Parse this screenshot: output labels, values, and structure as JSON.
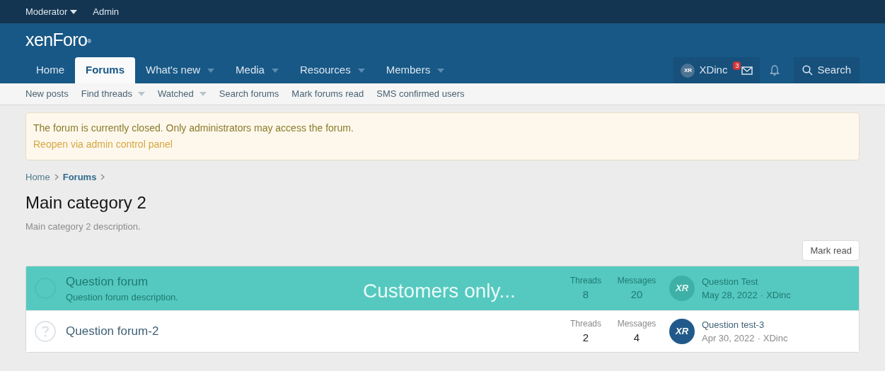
{
  "staff_bar": [
    {
      "label": "Moderator",
      "dropdown": true
    },
    {
      "label": "Admin",
      "dropdown": false
    }
  ],
  "logo": {
    "text": "xenForo",
    "mark": "®"
  },
  "nav_tabs": [
    {
      "label": "Home",
      "selected": false,
      "dropdown": false
    },
    {
      "label": "Forums",
      "selected": true,
      "dropdown": false
    },
    {
      "label": "What's new",
      "selected": false,
      "dropdown": true
    },
    {
      "label": "Media",
      "selected": false,
      "dropdown": true
    },
    {
      "label": "Resources",
      "selected": false,
      "dropdown": true
    },
    {
      "label": "Members",
      "selected": false,
      "dropdown": true
    }
  ],
  "account": {
    "avatar_text": "XR",
    "username": "XDinc",
    "inbox_count": "3",
    "search_label": "Search"
  },
  "sub_nav": [
    {
      "label": "New posts",
      "dropdown": false
    },
    {
      "label": "Find threads",
      "dropdown": true
    },
    {
      "label": "Watched",
      "dropdown": true
    },
    {
      "label": "Search forums",
      "dropdown": false
    },
    {
      "label": "Mark forums read",
      "dropdown": false
    },
    {
      "label": "SMS confirmed users",
      "dropdown": false
    }
  ],
  "notice": {
    "message": "The forum is currently closed. Only administrators may access the forum.",
    "link": "Reopen via admin control panel"
  },
  "breadcrumbs": [
    {
      "label": "Home",
      "current": false
    },
    {
      "label": "Forums",
      "current": true
    }
  ],
  "page": {
    "title": "Main category 2",
    "description": "Main category 2 description.",
    "mark_read": "Mark read"
  },
  "forums": [
    {
      "kind": "locked",
      "overlay": "Customers only...",
      "title": "Question forum",
      "description": "Question forum description.",
      "threads_label": "Threads",
      "threads": "8",
      "messages_label": "Messages",
      "messages": "20",
      "avatar_text": "XR",
      "last_title": "Question Test",
      "last_date": "May 28, 2022",
      "separator": "·",
      "last_user": "XDinc"
    },
    {
      "kind": "open",
      "title": "Question forum-2",
      "threads_label": "Threads",
      "threads": "2",
      "messages_label": "Messages",
      "messages": "4",
      "avatar_text": "XR",
      "last_title": "Question test-3",
      "last_date": "Apr 30, 2022",
      "separator": "·",
      "last_user": "XDinc"
    }
  ]
}
